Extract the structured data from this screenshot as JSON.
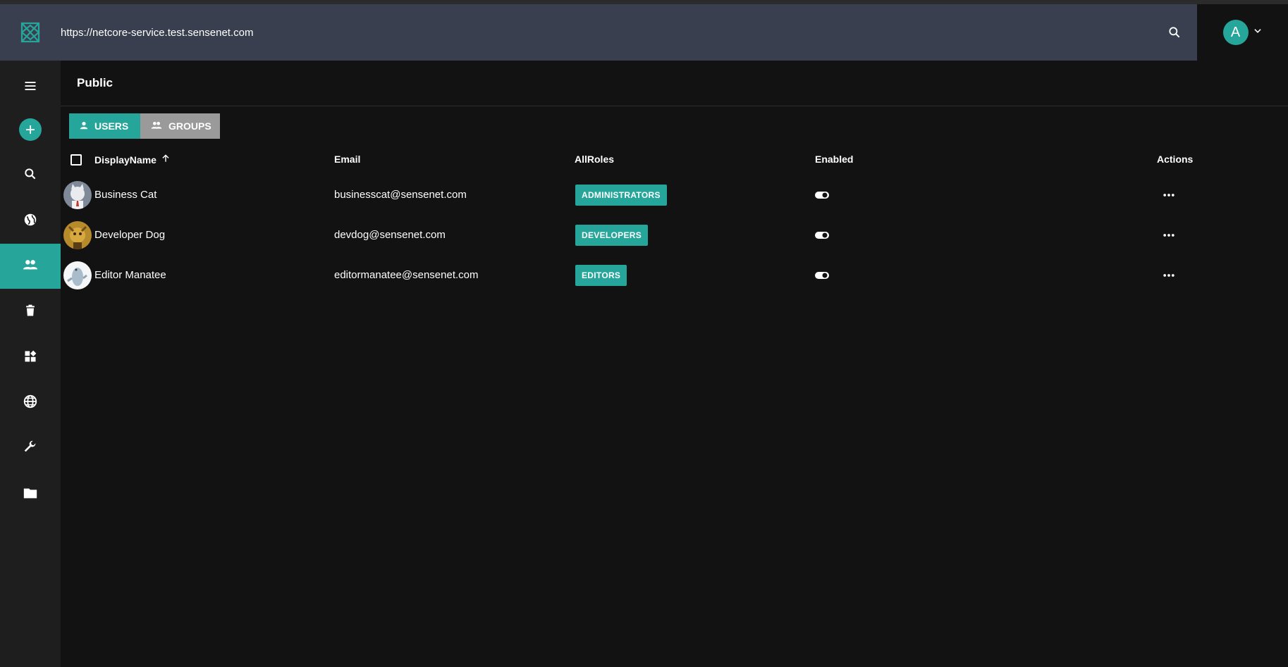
{
  "header": {
    "url": "https://netcore-service.test.sensenet.com",
    "user_initial": "A"
  },
  "sidebar": {
    "items": [
      {
        "name": "menu-icon"
      },
      {
        "name": "add-icon"
      },
      {
        "name": "search-icon"
      },
      {
        "name": "globe-icon"
      },
      {
        "name": "users-icon",
        "active": true
      },
      {
        "name": "trash-icon"
      },
      {
        "name": "widgets-icon"
      },
      {
        "name": "language-icon"
      },
      {
        "name": "wrench-icon"
      },
      {
        "name": "folder-icon"
      }
    ]
  },
  "page": {
    "title": "Public",
    "tabs": {
      "users": "USERS",
      "groups": "GROUPS"
    }
  },
  "table": {
    "columns": {
      "display_name": "DisplayName",
      "email": "Email",
      "roles": "AllRoles",
      "enabled": "Enabled",
      "actions": "Actions"
    },
    "rows": [
      {
        "name": "Business Cat",
        "email": "businesscat@sensenet.com",
        "role": "ADMINISTRATORS",
        "enabled": true
      },
      {
        "name": "Developer Dog",
        "email": "devdog@sensenet.com",
        "role": "DEVELOPERS",
        "enabled": true
      },
      {
        "name": "Editor Manatee",
        "email": "editormanatee@sensenet.com",
        "role": "EDITORS",
        "enabled": true
      }
    ]
  },
  "colors": {
    "accent": "#26a69a",
    "header_bg": "#3a3f50",
    "sidebar_bg": "#1e1e1e",
    "main_bg": "#121212",
    "groups_tab_bg": "#9a9a9a"
  }
}
